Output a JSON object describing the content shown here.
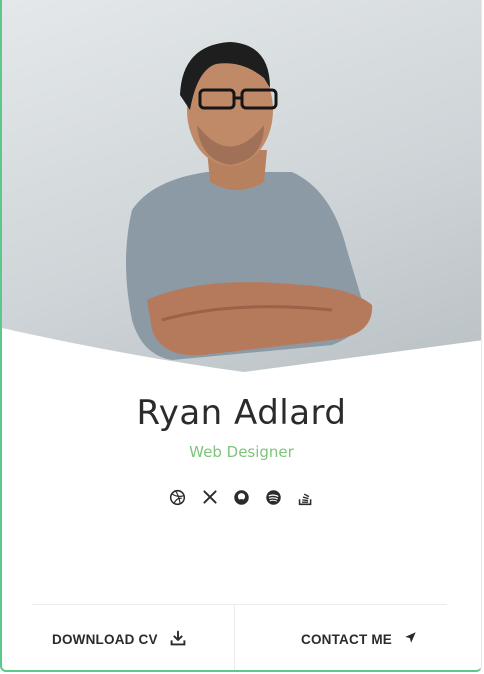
{
  "profile": {
    "name": "Ryan Adlard",
    "role": "Web Designer"
  },
  "socials": [
    {
      "icon": "dribbble-icon"
    },
    {
      "icon": "x-icon"
    },
    {
      "icon": "github-icon"
    },
    {
      "icon": "spotify-icon"
    },
    {
      "icon": "stackoverflow-icon"
    }
  ],
  "actions": {
    "download_label": "DOWNLOAD CV",
    "contact_label": "CONTACT ME"
  },
  "colors": {
    "accent": "#7ec47a",
    "border": "#5cc88a",
    "text": "#2b2b2b"
  }
}
